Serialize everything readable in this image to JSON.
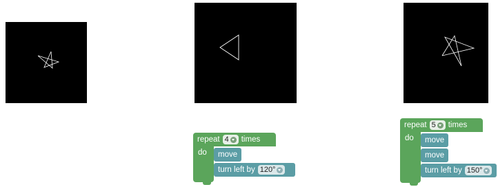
{
  "canvases": [
    {
      "shape": "star"
    },
    {
      "shape": "triangle"
    },
    {
      "shape": "star-skewed"
    }
  ],
  "colors": {
    "canvas_bg": "#000000",
    "stroke": "#ffffff",
    "loop_block": "#5ba55b",
    "turtle_block": "#5b9da5"
  },
  "program_triangle": {
    "repeat_label": "repeat",
    "repeat_count": "4",
    "times_label": "times",
    "do_label": "do",
    "move_labels": [
      "move"
    ],
    "turn_label": "turn left by",
    "turn_angle": "120°"
  },
  "program_star": {
    "repeat_label": "repeat",
    "repeat_count": "5",
    "times_label": "times",
    "do_label": "do",
    "move_labels": [
      "move",
      "move"
    ],
    "turn_label": "turn left by",
    "turn_angle": "150°"
  }
}
